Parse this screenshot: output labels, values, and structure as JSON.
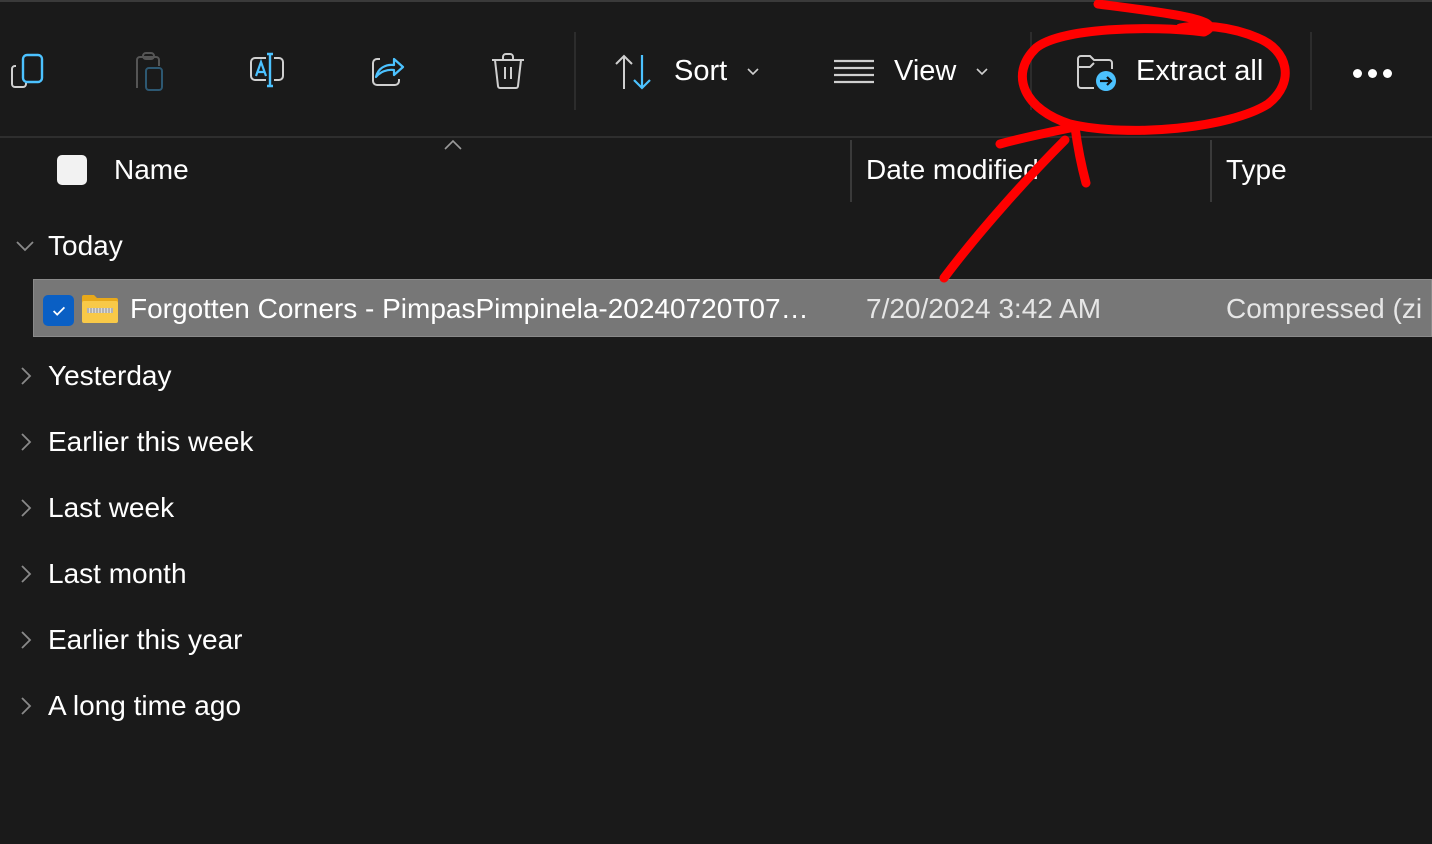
{
  "toolbar": {
    "icons": [
      {
        "name": "copy-icon",
        "tooltip": "Copy"
      },
      {
        "name": "paste-icon",
        "tooltip": "Paste"
      },
      {
        "name": "rename-icon",
        "tooltip": "Rename"
      },
      {
        "name": "share-icon",
        "tooltip": "Share"
      },
      {
        "name": "delete-icon",
        "tooltip": "Delete"
      }
    ],
    "sort_label": "Sort",
    "view_label": "View",
    "extract_all_label": "Extract all",
    "more_icon": "ellipsis-icon"
  },
  "columns": {
    "name": "Name",
    "date_modified": "Date modified",
    "type": "Type"
  },
  "groups": [
    {
      "label": "Today",
      "expanded": true
    },
    {
      "label": "Yesterday",
      "expanded": false
    },
    {
      "label": "Earlier this week",
      "expanded": false
    },
    {
      "label": "Last week",
      "expanded": false
    },
    {
      "label": "Last month",
      "expanded": false
    },
    {
      "label": "Earlier this year",
      "expanded": false
    },
    {
      "label": "A long time ago",
      "expanded": false
    }
  ],
  "files": [
    {
      "name": "Forgotten Corners - PimpasPimpinela-20240720T07…",
      "date_modified": "7/20/2024 3:42 AM",
      "type": "Compressed (zi",
      "selected": true,
      "icon": "zip-folder-icon"
    }
  ],
  "colors": {
    "accent": "#4cc2ff",
    "selection_bg": "#777777",
    "checkbox_checked": "#0a5fc4",
    "annotation": "#ff0000",
    "background": "#1a1a1a"
  }
}
